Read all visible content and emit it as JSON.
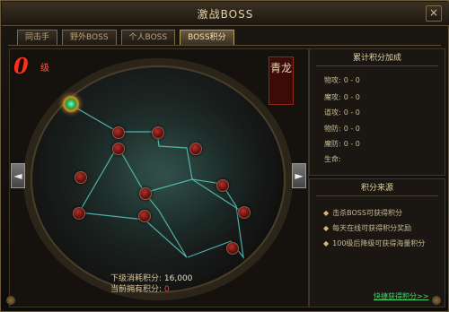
{
  "window": {
    "title": "激战BOSS",
    "close_label": "×"
  },
  "tabs": [
    {
      "label": "同击手"
    },
    {
      "label": "野外BOSS"
    },
    {
      "label": "个人BOSS"
    },
    {
      "label": "BOSS积分"
    }
  ],
  "active_tab_index": 3,
  "main": {
    "level_badge": "0",
    "level_suffix": "级",
    "boss_name": "青龙",
    "arrow_left": "◄",
    "arrow_right": "►",
    "next_level_cost_label": "下级消耗积分:",
    "next_level_cost_value": "16,000",
    "current_points_label": "当前拥有积分:",
    "current_points_value": "0"
  },
  "accumulated_panel": {
    "title": "累计积分加成",
    "stats": [
      {
        "label": "物攻:",
        "value": "0 - 0"
      },
      {
        "label": "魔攻:",
        "value": "0 - 0"
      },
      {
        "label": "道攻:",
        "value": "0 - 0"
      },
      {
        "label": "物防:",
        "value": "0 - 0"
      },
      {
        "label": "魔防:",
        "value": "0 - 0"
      },
      {
        "label": "生命:",
        "value": ""
      }
    ]
  },
  "source_panel": {
    "title": "积分来源",
    "items": [
      "击杀BOSS可获得积分",
      "每天在线可获得积分奖励",
      "100级后降级可获得海量积分"
    ],
    "link_label": "快捷获得积分>>"
  },
  "colors": {
    "accent_red": "#ff2d1d",
    "link_green": "#46d66a",
    "gold_text": "#e6d3a5"
  }
}
